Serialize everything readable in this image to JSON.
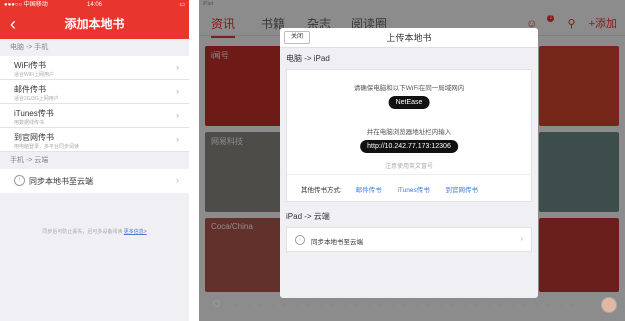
{
  "phone": {
    "status": {
      "carrier": "●●●○○ 中国移动 ",
      "time": "14:06",
      "battery": "▭"
    },
    "nav": {
      "back": "‹",
      "title": "添加本地书"
    },
    "section_pc": "电脑 -> 手机",
    "items": [
      {
        "title": "WiFi传书",
        "subtitle": "适合WiFi上网用户"
      },
      {
        "title": "邮件传书",
        "subtitle": "适合2G/3G上网用户"
      },
      {
        "title": "iTunes传书",
        "subtitle": "用数据线传书"
      },
      {
        "title": "到官网传书",
        "subtitle": "用电脑登录，多平台同步阅读"
      }
    ],
    "section_cloud": "手机 -> 云端",
    "cloud_item": "同步本地书至云端",
    "note": "同步后可防止丢失，且可多设备阅读",
    "note_link": "更多信息>"
  },
  "ipad": {
    "status": {
      "left": "iPad ",
      "center": "",
      "right": ""
    },
    "tabs": [
      "资讯",
      "书籍",
      "杂志",
      "阅读圈"
    ],
    "actions": {
      "badge": "1",
      "add": "+添加"
    },
    "tiles": [
      {
        "caption": "i闻号"
      },
      {
        "caption": "网易科技"
      },
      {
        "caption": "Coca/China"
      }
    ],
    "modal": {
      "close": "关闭",
      "title": "上传本地书",
      "section_wifi": "电脑 -> iPad",
      "instruction1": "请确保电脑和以下WiFi在同一局域网内",
      "wifi_name": "NetEase",
      "instruction2": "并在电脑浏览器地址栏内输入",
      "address": "http://10.242.77.173:12306",
      "hint": "注意使用英文冒号",
      "others_label": "其他传书方式:",
      "others": [
        "邮件传书",
        "iTunes传书",
        "到官网传书"
      ],
      "section_cloud": "iPad -> 云端",
      "cloud_item": "同步本地书至云端"
    }
  },
  "colors": {
    "brand_red": "#e8352d",
    "link_blue": "#3a7dd8"
  }
}
